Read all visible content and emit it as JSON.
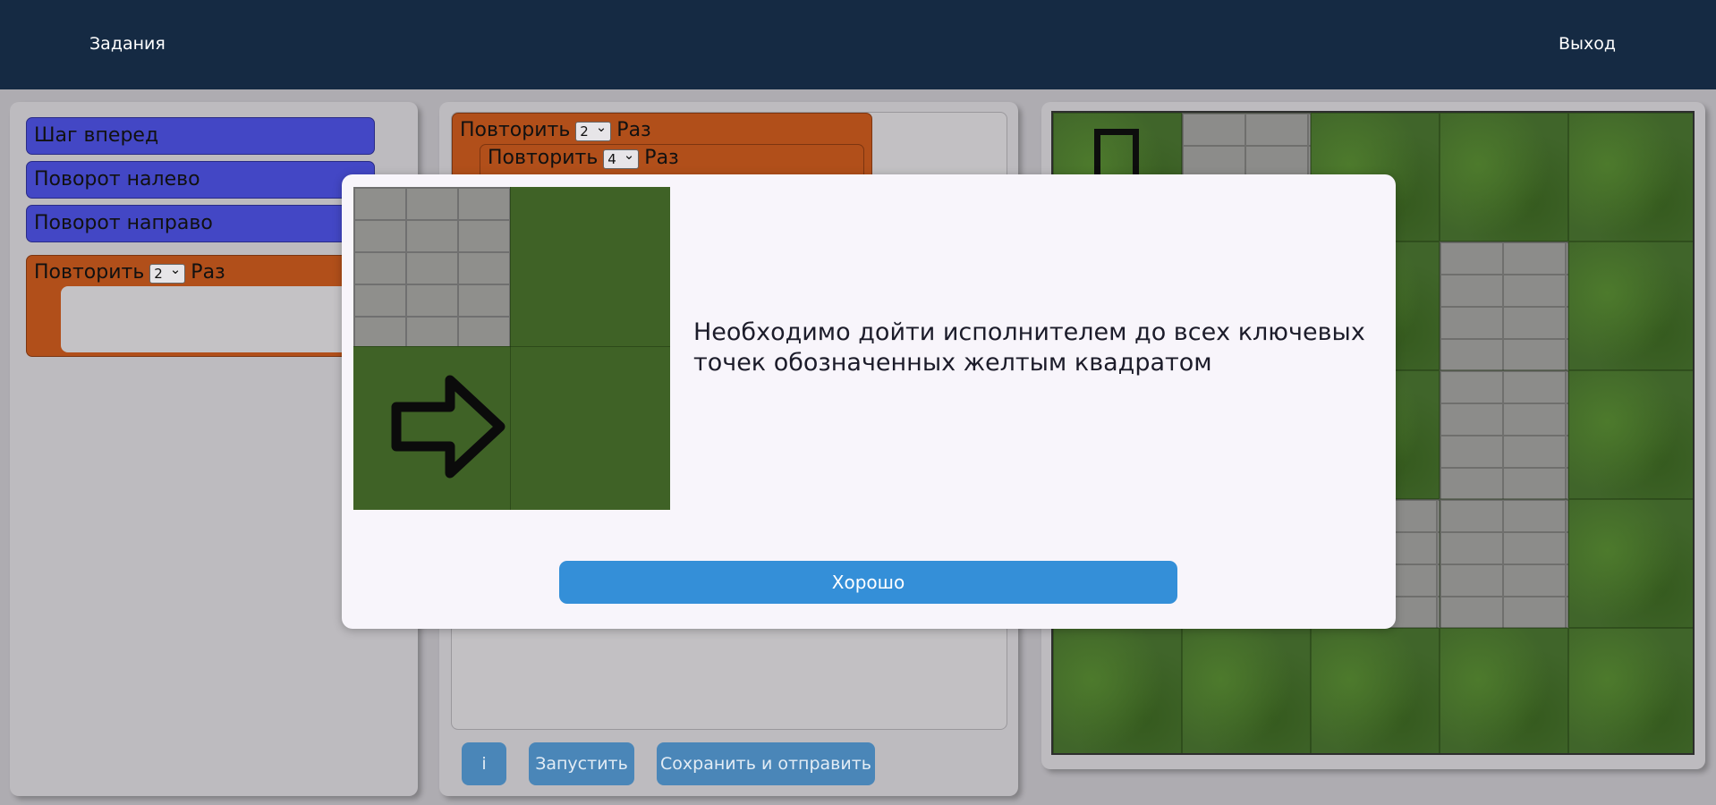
{
  "header": {
    "tasks_link": "Задания",
    "exit_link": "Выход",
    "background_color": "#152a43"
  },
  "commands_panel": {
    "items": [
      {
        "label": "Шаг вперед"
      },
      {
        "label": "Поворот налево"
      },
      {
        "label": "Поворот направо"
      }
    ],
    "repeat_block": {
      "label_before": "Повторить",
      "count": "2",
      "label_after": "Раз"
    }
  },
  "program_panel": {
    "outer_repeat": {
      "label_before": "Повторить",
      "count": "2",
      "label_after": "Раз"
    },
    "inner_repeat": {
      "label_before": "Повторить",
      "count": "4",
      "label_after": "Раз"
    },
    "buttons": {
      "info": "i",
      "run": "Запустить",
      "save_submit": "Сохранить и отправить"
    }
  },
  "field": {
    "key_point_color": "#c8c224"
  },
  "modal": {
    "message": "Необходимо дойти исполнителем до всех ключевых точек обозначенных желтым квадратом",
    "ok_button": "Хорошо"
  },
  "colors": {
    "command_block": "#4347c5",
    "repeat_block": "#b14f1a",
    "action_button": "#4a86b8",
    "modal_button": "#348fd8"
  },
  "icons": {
    "arrow": "arrow-right-icon"
  }
}
